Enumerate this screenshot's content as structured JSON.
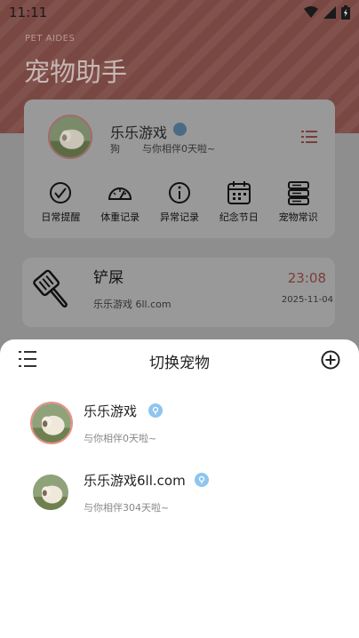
{
  "status_bar": {
    "time": "11:11"
  },
  "header": {
    "subtitle": "PET AIDES",
    "title": "宠物助手"
  },
  "current_pet": {
    "name": "乐乐游戏",
    "type": "狗",
    "days_text": "与你相伴0天啦~"
  },
  "features": [
    {
      "label": "日常提醒",
      "icon": "check-circle-icon"
    },
    {
      "label": "体重记录",
      "icon": "gauge-icon"
    },
    {
      "label": "异常记录",
      "icon": "info-circle-icon"
    },
    {
      "label": "纪念节日",
      "icon": "calendar-icon"
    },
    {
      "label": "宠物常识",
      "icon": "server-stack-icon"
    }
  ],
  "task": {
    "title": "铲屎",
    "subtitle": "乐乐游戏 6ll.com",
    "time": "23:08",
    "date": "2025-11-04"
  },
  "sheet": {
    "title": "切换宠物",
    "pets": [
      {
        "name": "乐乐游戏",
        "days_text": "与你相伴0天啦~",
        "selected": true
      },
      {
        "name": "乐乐游戏6ll.com",
        "days_text": "与你相伴304天啦~",
        "selected": false
      }
    ]
  },
  "colors": {
    "accent": "#e8908a",
    "badge": "#8ec5ef",
    "time_red": "#e16a62"
  }
}
